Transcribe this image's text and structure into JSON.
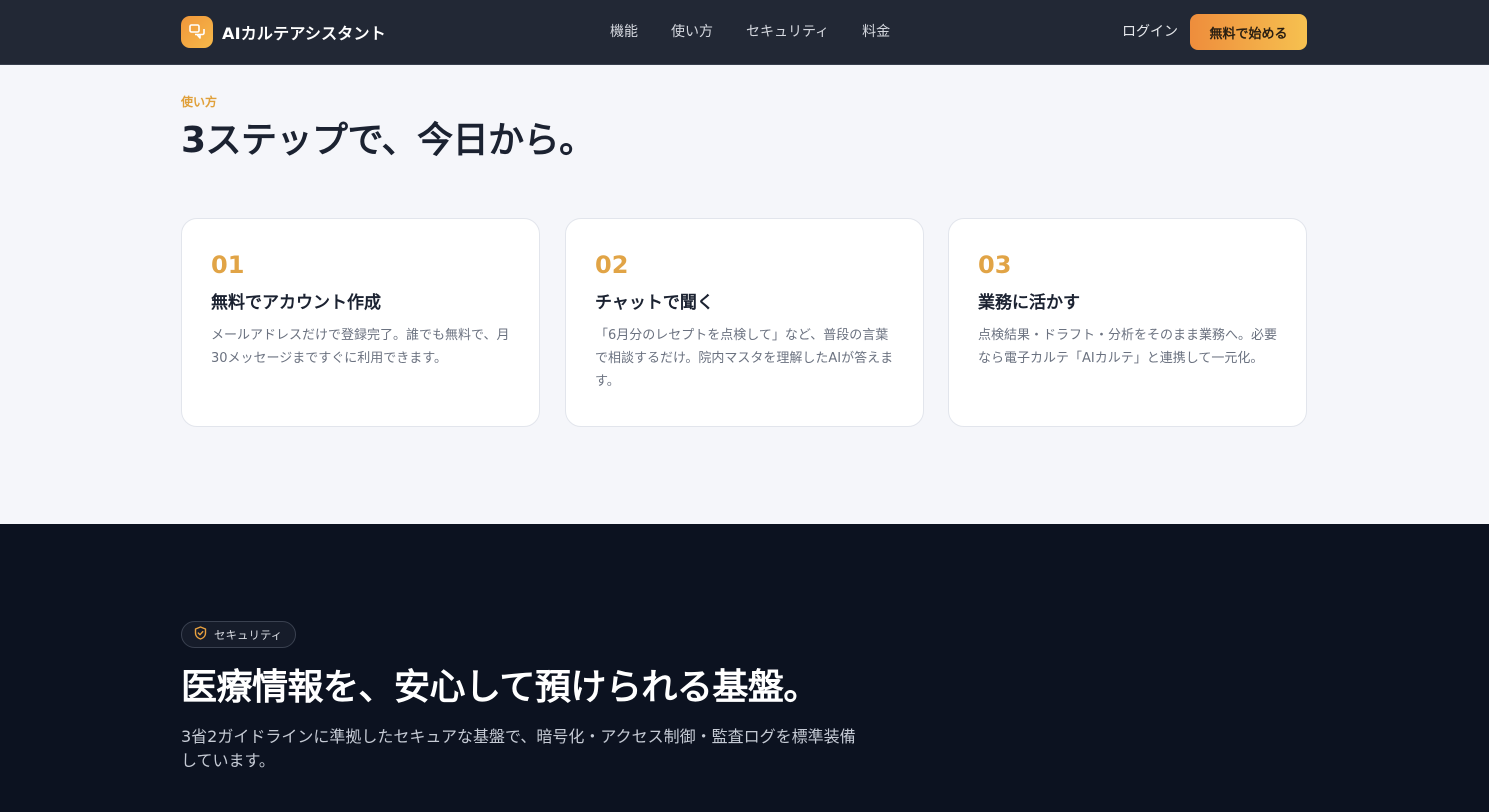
{
  "header": {
    "brand_name": "AIカルテアシスタント",
    "nav": [
      "機能",
      "使い方",
      "セキュリティ",
      "料金"
    ],
    "login_label": "ログイン",
    "cta_label": "無料で始める"
  },
  "howto": {
    "eyebrow": "使い方",
    "title": "3ステップで、今日から。",
    "steps": [
      {
        "num": "01",
        "title": "無料でアカウント作成",
        "desc": "メールアドレスだけで登録完了。誰でも無料で、月30メッセージまですぐに利用できます。"
      },
      {
        "num": "02",
        "title": "チャットで聞く",
        "desc": "「6月分のレセプトを点検して」など、普段の言葉で相談するだけ。院内マスタを理解したAIが答えます。"
      },
      {
        "num": "03",
        "title": "業務に活かす",
        "desc": "点検結果・ドラフト・分析をそのまま業務へ。必要なら電子カルテ「AIカルテ」と連携して一元化。"
      }
    ]
  },
  "security": {
    "badge_label": "セキュリティ",
    "badge_icon": "shield-check-icon",
    "title": "医療情報を、安心して預けられる基盤。",
    "desc": "3省2ガイドラインに準拠したセキュアな基盤で、暗号化・アクセス制御・監査ログを標準装備しています。"
  },
  "colors": {
    "accent": "#e0a03a",
    "header_bg": "#222835",
    "security_bg": "#0c1220"
  }
}
